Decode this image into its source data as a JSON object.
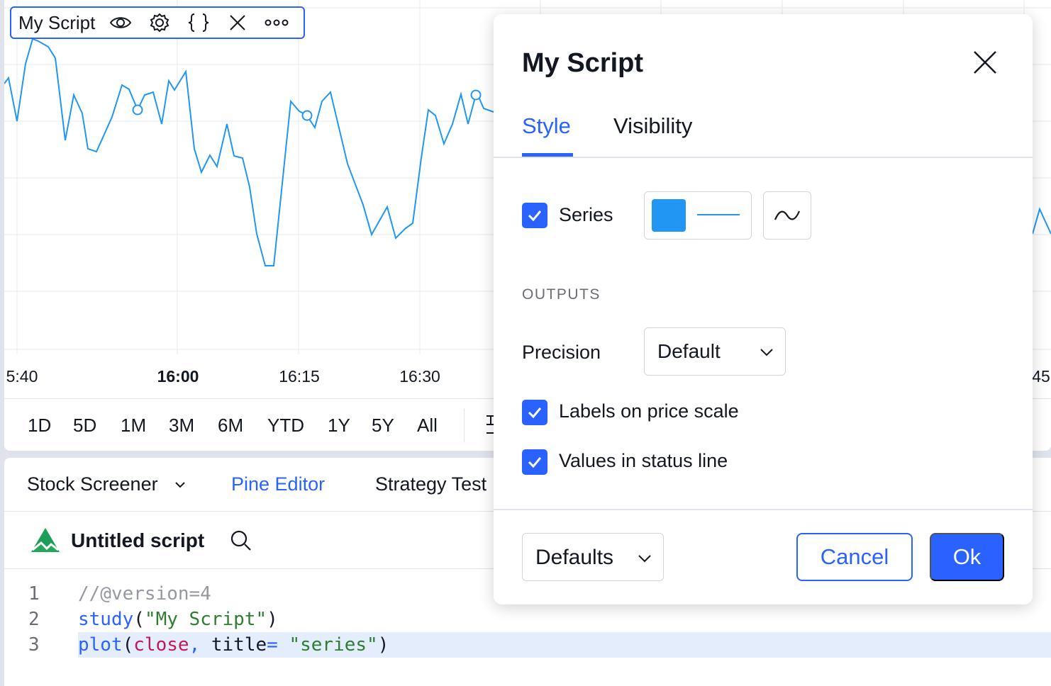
{
  "legend": {
    "title": "My Script",
    "icons": [
      "eye-icon",
      "gear-icon",
      "braces-icon",
      "close-icon",
      "more-icon"
    ]
  },
  "chart": {
    "line_color": "#2196f3",
    "time_labels": [
      "5:40",
      "16:00",
      "16:15",
      "16:30",
      "45"
    ],
    "time_label_bold": "16:00"
  },
  "range_buttons": [
    "1D",
    "5D",
    "1M",
    "3M",
    "6M",
    "YTD",
    "1Y",
    "5Y",
    "All"
  ],
  "bottom_tabs": {
    "screener": "Stock Screener",
    "pine": "Pine Editor",
    "strategy": "Strategy Test"
  },
  "script": {
    "name": "Untitled script"
  },
  "code": {
    "line_numbers": [
      "1",
      "2",
      "3"
    ],
    "line1": "//@version=4",
    "line2_fn": "study",
    "line2_open": "(",
    "line2_str": "\"My Script\"",
    "line2_close": ")",
    "line3_fn": "plot",
    "line3_open": "(",
    "line3_var": "close",
    "line3_comma": ",",
    "line3_param": " title",
    "line3_eq": "=",
    "line3_str": " \"series\"",
    "line3_close": ")"
  },
  "dialog": {
    "title": "My Script",
    "tabs": {
      "style": "Style",
      "visibility": "Visibility"
    },
    "series_label": "Series",
    "series_color": "#2196f3",
    "outputs_header": "OUTPUTS",
    "precision_label": "Precision",
    "precision_value": "Default",
    "labels_on_price_scale": "Labels on price scale",
    "values_in_status_line": "Values in status line",
    "defaults_value": "Defaults",
    "cancel": "Cancel",
    "ok": "Ok",
    "accent": "#2962ff"
  }
}
